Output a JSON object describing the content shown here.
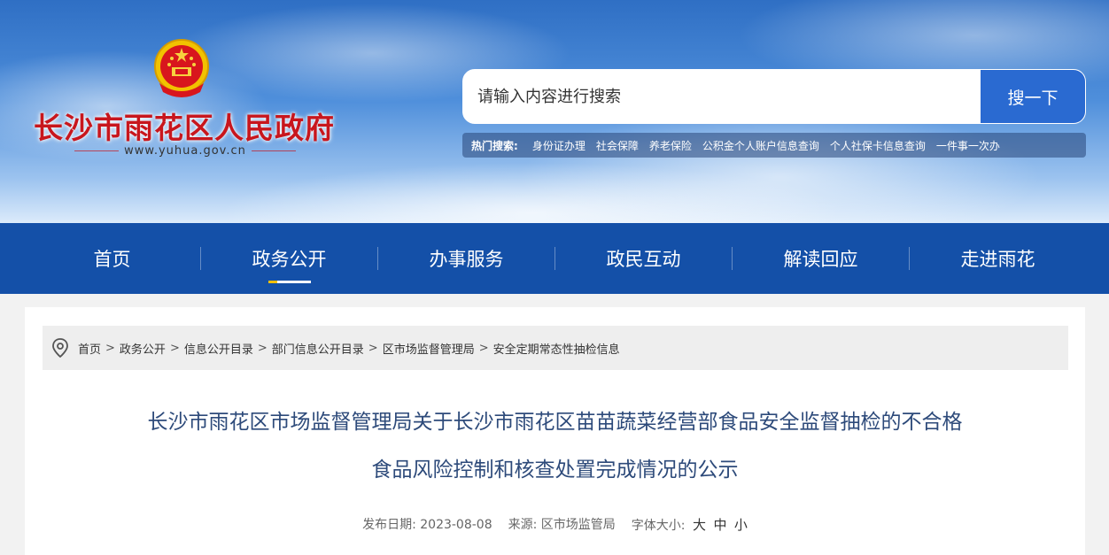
{
  "header": {
    "site_title": "长沙市雨花区人民政府",
    "site_domain": "www.yuhua.gov.cn",
    "emblem_icon": "national-emblem-icon",
    "search": {
      "placeholder": "请输入内容进行搜索",
      "button_label": "搜一下"
    },
    "hot_search": {
      "label": "热门搜索:",
      "items": [
        "身份证办理",
        "社会保障",
        "养老保险",
        "公积金个人账户信息查询",
        "个人社保卡信息查询",
        "一件事一次办"
      ]
    }
  },
  "nav": {
    "items": [
      "首页",
      "政务公开",
      "办事服务",
      "政民互动",
      "解读回应",
      "走进雨花"
    ],
    "active_index": 1
  },
  "breadcrumb": {
    "icon": "location-pin-icon",
    "items": [
      "首页",
      "政务公开",
      "信息公开目录",
      "部门信息公开目录",
      "区市场监督管理局",
      "安全定期常态性抽检信息"
    ],
    "separator": ">"
  },
  "article": {
    "title_line1": "长沙市雨花区市场监督管理局关于长沙市雨花区苗苗蔬菜经营部食品安全监督抽检的不合格",
    "title_line2": "食品风险控制和核查处置完成情况的公示",
    "meta": {
      "date_label": "发布日期:",
      "date": "2023-08-08",
      "source_label": "来源:",
      "source": "区市场监管局",
      "font_size_label": "字体大小:",
      "font_size_options": [
        "大",
        "中",
        "小"
      ]
    }
  },
  "colors": {
    "nav_bg": "#1450a8",
    "title_red": "#c8161d",
    "search_button": "#2a6ad1",
    "article_title": "#2d4a7a"
  }
}
